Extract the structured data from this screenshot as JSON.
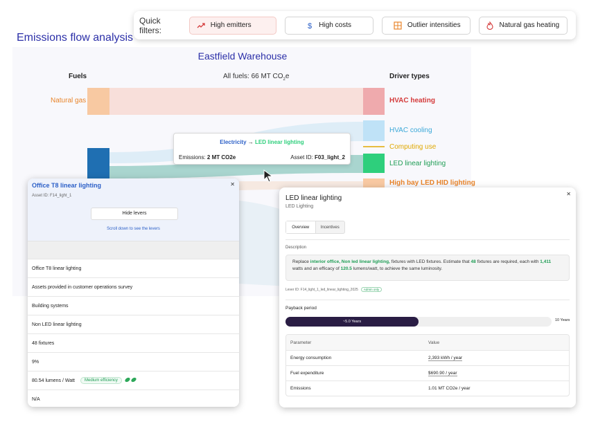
{
  "page": {
    "title": "Emissions flow analysis"
  },
  "quick_filters": {
    "label": "Quick filters:",
    "items": [
      {
        "label": "High emitters",
        "icon": "trending-up-icon",
        "active": true
      },
      {
        "label": "High costs",
        "icon": "dollar-icon",
        "active": false
      },
      {
        "label": "Outlier intensities",
        "icon": "grid-alert-icon",
        "active": false
      },
      {
        "label": "Natural gas heating",
        "icon": "flame-icon",
        "active": false
      }
    ]
  },
  "sankey": {
    "title": "Eastfield Warehouse",
    "left_header": "Fuels",
    "right_header": "Driver types",
    "total_prefix": "All fuels: 66 MT CO",
    "total_sub": "2",
    "total_suffix": "e",
    "fuels": [
      {
        "label": "Natural gas",
        "color": "#e8842a"
      }
    ],
    "drivers": [
      {
        "label": "HVAC heating",
        "color": "#d43a3a"
      },
      {
        "label": "HVAC cooling",
        "color": "#3aa8d8"
      },
      {
        "label": "Computing use",
        "color": "#e0a800"
      },
      {
        "label": "LED linear lighting",
        "color": "#1f9d55"
      },
      {
        "label": "High bay LED HID lighting",
        "color": "#e8842a"
      }
    ],
    "tooltip": {
      "from": "Electricity",
      "arrow": "→",
      "to": "LED linear lighting",
      "emissions_label": "Emissions: ",
      "emissions_value": "2 MT CO2e",
      "asset_label": "Asset ID: ",
      "asset_value": "F03_light_2"
    }
  },
  "left_panel": {
    "title": "Office T8 linear lighting",
    "asset_id": "Asset ID: F14_light_1",
    "close": "✕",
    "hide_button": "Hide levers",
    "scroll_hint": "Scroll down to see the levers",
    "rows": [
      "Office T8 linear lighting",
      "Assets provided in customer operations survey",
      "Building systems",
      "Non LED linear lighting",
      "48 fixtures",
      "9%",
      "80.54 lumens / Watt",
      "N/A"
    ],
    "efficiency_badge": "Medium efficiency"
  },
  "right_panel": {
    "title": "LED linear lighting",
    "subtitle": "LED Lighting",
    "close": "✕",
    "tabs": [
      "Overview",
      "Incentives"
    ],
    "description_label": "Description",
    "description": {
      "t1": "Replace ",
      "h1": "interior office, Non led linear lighting,",
      "t2": " fixtures with LED fixtures. Estimate that ",
      "h2": "48",
      "t3": " fixtures are required, each with ",
      "h3": "1,411",
      "t4": " watts and an efficacy of ",
      "h4": "120.5",
      "t5": " lumens/watt, to achieve the same luminosity."
    },
    "lever_id": "Lever ID: F14_light_1_led_linear_lighting_2025",
    "lever_badge": "Admin only",
    "payback_label": "Payback period",
    "payback_value": "~5.0 Years",
    "payback_fraction": 0.5,
    "payback_max": "10 Years",
    "table_headers": [
      "Parameter",
      "Value"
    ],
    "table_rows": [
      {
        "param": "Energy consumption",
        "value": "2,393 kWh / year"
      },
      {
        "param": "Fuel expenditure",
        "value": "$690.90 / year"
      },
      {
        "param": "Emissions",
        "value": "1.01 MT CO2e / year"
      }
    ]
  }
}
